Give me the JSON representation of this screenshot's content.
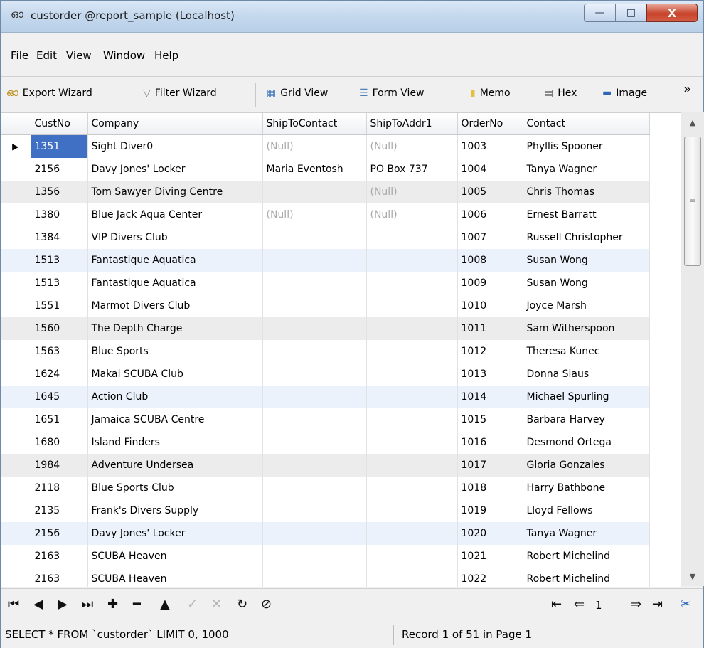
{
  "window": {
    "title": "custorder @report_sample (Localhost)",
    "icon": "glasses-icon",
    "buttons": {
      "minimize": "—",
      "maximize": "□",
      "close": "X"
    }
  },
  "menu": [
    "File",
    "Edit",
    "View",
    "Window",
    "Help"
  ],
  "toolbar": {
    "export_wizard": "Export Wizard",
    "filter_wizard": "Filter Wizard",
    "grid_view": "Grid View",
    "form_view": "Form View",
    "memo": "Memo",
    "hex": "Hex",
    "image": "Image",
    "overflow": "»"
  },
  "grid": {
    "columns": [
      "CustNo",
      "Company",
      "ShipToContact",
      "ShipToAddr1",
      "OrderNo",
      "Contact"
    ],
    "rows": [
      [
        "1351",
        "Sight Diver0",
        "(Null)",
        "(Null)",
        "1003",
        "Phyllis Spooner"
      ],
      [
        "2156",
        "Davy Jones' Locker",
        "Maria Eventosh",
        "PO Box 737",
        "1004",
        "Tanya Wagner"
      ],
      [
        "1356",
        "Tom Sawyer Diving Centre",
        "",
        "(Null)",
        "1005",
        "Chris Thomas"
      ],
      [
        "1380",
        "Blue Jack Aqua Center",
        "(Null)",
        "(Null)",
        "1006",
        "Ernest Barratt"
      ],
      [
        "1384",
        "VIP Divers Club",
        "",
        "",
        "1007",
        "Russell Christopher"
      ],
      [
        "1513",
        "Fantastique Aquatica",
        "",
        "",
        "1008",
        "Susan Wong"
      ],
      [
        "1513",
        "Fantastique Aquatica",
        "",
        "",
        "1009",
        "Susan Wong"
      ],
      [
        "1551",
        "Marmot Divers Club",
        "",
        "",
        "1010",
        "Joyce Marsh"
      ],
      [
        "1560",
        "The Depth Charge",
        "",
        "",
        "1011",
        "Sam Witherspoon"
      ],
      [
        "1563",
        "Blue Sports",
        "",
        "",
        "1012",
        "Theresa Kunec"
      ],
      [
        "1624",
        "Makai SCUBA Club",
        "",
        "",
        "1013",
        "Donna Siaus"
      ],
      [
        "1645",
        "Action Club",
        "",
        "",
        "1014",
        "Michael Spurling"
      ],
      [
        "1651",
        "Jamaica SCUBA Centre",
        "",
        "",
        "1015",
        "Barbara Harvey"
      ],
      [
        "1680",
        "Island Finders",
        "",
        "",
        "1016",
        "Desmond Ortega"
      ],
      [
        "1984",
        "Adventure Undersea",
        "",
        "",
        "1017",
        "Gloria Gonzales"
      ],
      [
        "2118",
        "Blue Sports Club",
        "",
        "",
        "1018",
        "Harry Bathbone"
      ],
      [
        "2135",
        "Frank's Divers Supply",
        "",
        "",
        "1019",
        "Lloyd Fellows"
      ],
      [
        "2156",
        "Davy Jones' Locker",
        "",
        "",
        "1020",
        "Tanya Wagner"
      ],
      [
        "2163",
        "SCUBA Heaven",
        "",
        "",
        "1021",
        "Robert Michelind"
      ],
      [
        "2163",
        "SCUBA Heaven",
        "",
        "",
        "1022",
        "Robert Michelind"
      ]
    ],
    "row_shading": [
      "none",
      "none",
      "gray",
      "none",
      "none",
      "blue",
      "none",
      "none",
      "gray",
      "none",
      "none",
      "blue",
      "none",
      "none",
      "gray",
      "none",
      "none",
      "blue",
      "none",
      "none"
    ],
    "active_row": 0
  },
  "navigator": {
    "first": "⏮",
    "prev": "◀",
    "next": "▶",
    "last": "⏭",
    "add": "✚",
    "delete": "━",
    "post": "▲",
    "apply": "✓",
    "cancel": "✕",
    "refresh": "↻",
    "stop": "⊘",
    "page_first": "⇤",
    "page_prev": "⇐",
    "page_number": "1",
    "page_next": "⇒",
    "page_last": "⇥"
  },
  "status": {
    "sql": "SELECT * FROM `custorder` LIMIT 0, 1000",
    "record": "Record 1 of 51 in Page 1"
  }
}
